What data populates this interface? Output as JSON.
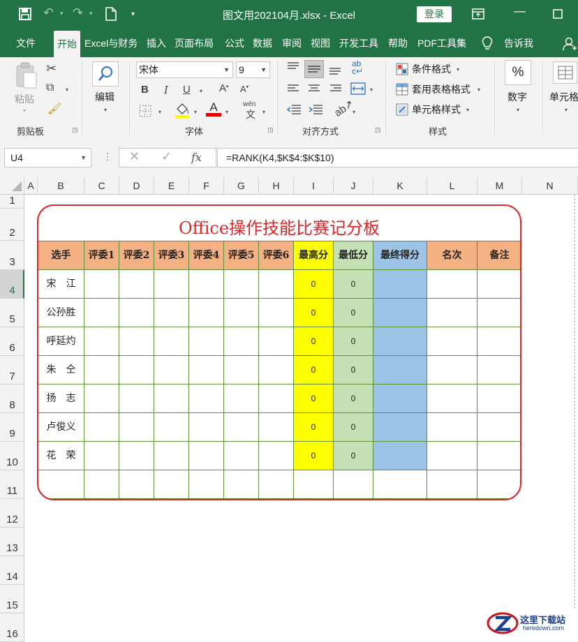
{
  "window": {
    "title": "图文用202104月.xlsx  -  Excel",
    "login_label": "登录"
  },
  "tabs": [
    {
      "label": "文件"
    },
    {
      "label": "开始",
      "active": true
    },
    {
      "label": "Excel与财务"
    },
    {
      "label": "插入"
    },
    {
      "label": "页面布局"
    },
    {
      "label": "公式"
    },
    {
      "label": "数据"
    },
    {
      "label": "审阅"
    },
    {
      "label": "视图"
    },
    {
      "label": "开发工具"
    },
    {
      "label": "帮助"
    },
    {
      "label": "PDF工具集"
    },
    {
      "label": "告诉我"
    }
  ],
  "ribbon": {
    "clipboard": {
      "paste": "粘贴",
      "label": "剪贴板"
    },
    "edit": {
      "label": "编辑"
    },
    "font": {
      "name": "宋体",
      "size": "9",
      "label": "字体",
      "bold": "B",
      "italic": "I",
      "underline": "U",
      "phonetic": "wén"
    },
    "alignment": {
      "label": "对齐方式"
    },
    "styles": {
      "conditional": "条件格式",
      "table": "套用表格格式",
      "cell_styles": "单元格样式",
      "label": "样式"
    },
    "number": {
      "label": "数字",
      "percent": "%"
    },
    "cells": {
      "label": "单元格"
    }
  },
  "formula_bar": {
    "name_box": "U4",
    "formula": "=RANK(K4,$K$4:$K$10)",
    "fx": "fx"
  },
  "sheet": {
    "columns": [
      "A",
      "B",
      "C",
      "D",
      "E",
      "F",
      "G",
      "H",
      "I",
      "J",
      "K",
      "L",
      "M",
      "N"
    ],
    "rows": [
      "1",
      "2",
      "3",
      "4",
      "5",
      "6",
      "7",
      "8",
      "9",
      "10",
      "11",
      "12",
      "13",
      "14",
      "15",
      "16"
    ],
    "active_cell": "U4",
    "board_title": "Office操作技能比赛记分板",
    "headers": [
      "选手",
      "评委1",
      "评委2",
      "评委3",
      "评委4",
      "评委5",
      "评委6",
      "最高分",
      "最低分",
      "最终得分",
      "名次",
      "备注"
    ],
    "players": [
      {
        "name": "宋　江",
        "max": "0",
        "min": "0"
      },
      {
        "name": "公孙胜",
        "max": "0",
        "min": "0"
      },
      {
        "name": "呼延灼",
        "max": "0",
        "min": "0"
      },
      {
        "name": "朱　仝",
        "max": "0",
        "min": "0"
      },
      {
        "name": "扬　志",
        "max": "0",
        "min": "0"
      },
      {
        "name": "卢俊义",
        "max": "0",
        "min": "0"
      },
      {
        "name": "花　荣",
        "max": "0",
        "min": "0"
      }
    ]
  },
  "watermark": {
    "title": "这里下载站",
    "url": "heredown.com"
  },
  "colors": {
    "brand": "#217346",
    "board_border": "#d9282a",
    "header_fill": "#f4b183",
    "max_fill": "#ffff00",
    "min_fill": "#c5e0b4",
    "final_fill": "#9dc3e6"
  }
}
